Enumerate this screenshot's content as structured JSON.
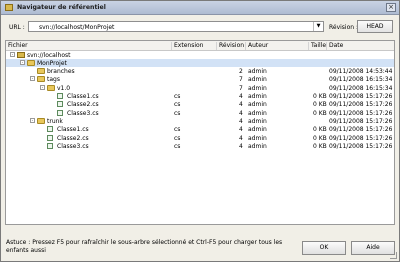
{
  "window": {
    "title": "Navigateur de référentiel",
    "close_label": "×"
  },
  "toolbar": {
    "url_label": "URL :",
    "url_value": "svn://localhost/MonProjet",
    "revision_label": "Révision :",
    "head_label": "HEAD"
  },
  "columns": [
    "Fichier",
    "Extension",
    "Révision",
    "Auteur",
    "Taille",
    "Date"
  ],
  "rows": [
    {
      "name": "svn://localhost",
      "icon": "repo-icon",
      "depth": 0,
      "expander": "-",
      "ext": "",
      "rev": "",
      "author": "",
      "size": "",
      "date": ""
    },
    {
      "name": "MonProjet",
      "icon": "folder-icon",
      "depth": 1,
      "expander": "-",
      "ext": "",
      "rev": "",
      "author": "",
      "size": "",
      "date": "",
      "selected": true
    },
    {
      "name": "branches",
      "icon": "folder-icon",
      "depth": 2,
      "expander": "",
      "ext": "",
      "rev": "2",
      "author": "admin",
      "size": "",
      "date": "09/11/2008 14:53:44"
    },
    {
      "name": "tags",
      "icon": "folder-icon",
      "depth": 2,
      "expander": "-",
      "ext": "",
      "rev": "7",
      "author": "admin",
      "size": "",
      "date": "09/11/2008 16:15:34"
    },
    {
      "name": "v1.0",
      "icon": "folder-icon",
      "depth": 3,
      "expander": "-",
      "ext": "",
      "rev": "7",
      "author": "admin",
      "size": "",
      "date": "09/11/2008 16:15:34"
    },
    {
      "name": "Classe1.cs",
      "icon": "file-icon",
      "depth": 4,
      "expander": "",
      "ext": "cs",
      "rev": "4",
      "author": "admin",
      "size": "0 KB",
      "date": "09/11/2008 15:17:26"
    },
    {
      "name": "Classe2.cs",
      "icon": "file-icon",
      "depth": 4,
      "expander": "",
      "ext": "cs",
      "rev": "4",
      "author": "admin",
      "size": "0 KB",
      "date": "09/11/2008 15:17:26"
    },
    {
      "name": "Classe3.cs",
      "icon": "file-icon",
      "depth": 4,
      "expander": "",
      "ext": "cs",
      "rev": "4",
      "author": "admin",
      "size": "0 KB",
      "date": "09/11/2008 15:17:26"
    },
    {
      "name": "trunk",
      "icon": "folder-icon",
      "depth": 2,
      "expander": "-",
      "ext": "",
      "rev": "4",
      "author": "admin",
      "size": "",
      "date": "09/11/2008 15:17:26"
    },
    {
      "name": "Classe1.cs",
      "icon": "file-icon",
      "depth": 3,
      "expander": "",
      "ext": "cs",
      "rev": "4",
      "author": "admin",
      "size": "0 KB",
      "date": "09/11/2008 15:17:26"
    },
    {
      "name": "Classe2.cs",
      "icon": "file-icon",
      "depth": 3,
      "expander": "",
      "ext": "cs",
      "rev": "4",
      "author": "admin",
      "size": "0 KB",
      "date": "09/11/2008 15:17:26"
    },
    {
      "name": "Classe3.cs",
      "icon": "file-icon",
      "depth": 3,
      "expander": "",
      "ext": "cs",
      "rev": "4",
      "author": "admin",
      "size": "0 KB",
      "date": "09/11/2008 15:17:26"
    }
  ],
  "status": {
    "text": "Astuce : Pressez F5 pour rafraîchir le sous-arbre sélectionné et Ctrl-F5 pour charger tous les enfants aussi"
  },
  "buttons": {
    "ok": "OK",
    "help": "Aide"
  }
}
